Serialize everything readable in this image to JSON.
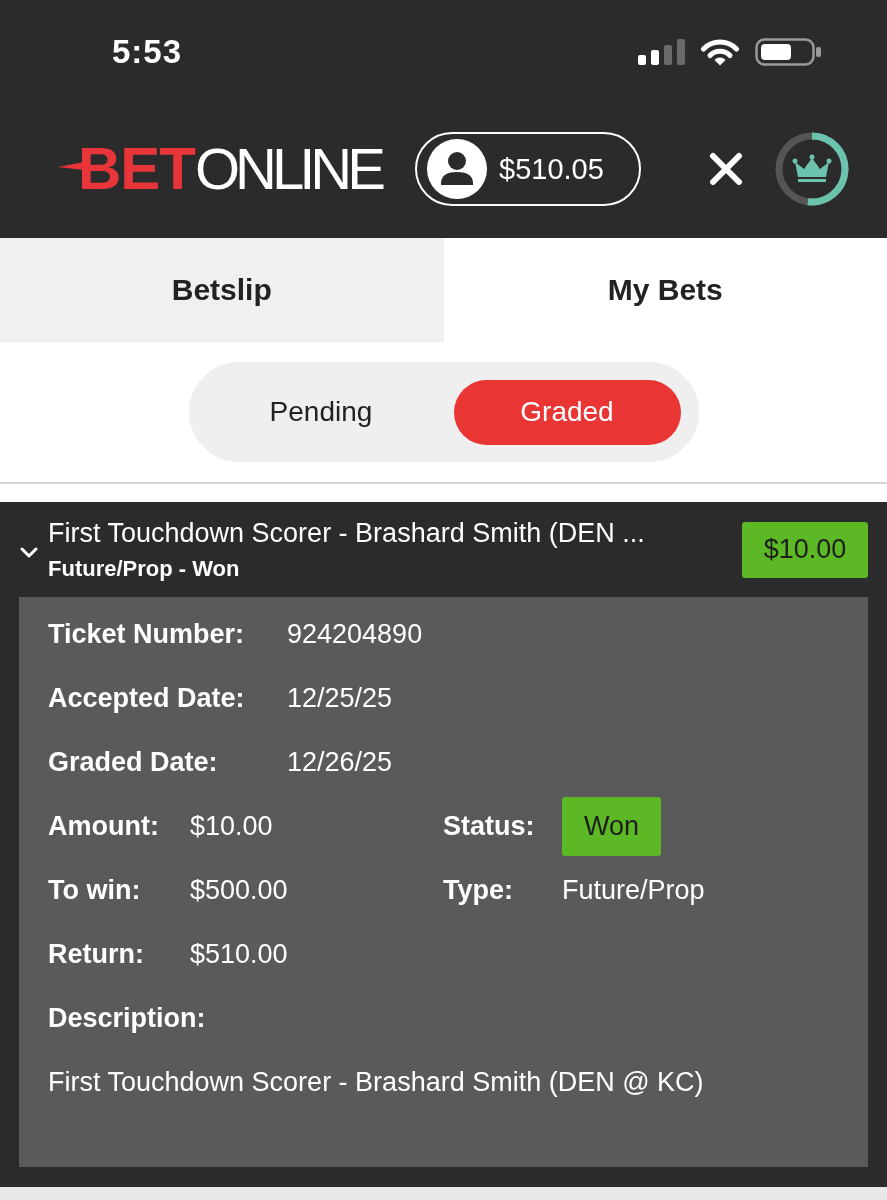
{
  "status_bar": {
    "time": "5:53"
  },
  "header": {
    "logo": [
      "BET",
      "ONLINE"
    ],
    "balance": "$510.05",
    "rewards": {
      "level": 0.52
    }
  },
  "tabs": [
    {
      "label": "Betslip",
      "selected": false
    },
    {
      "label": "My Bets",
      "selected": true
    }
  ],
  "filters": [
    {
      "label": "Pending",
      "selected": false
    },
    {
      "label": "Graded",
      "selected": true
    }
  ],
  "bets": [
    {
      "title": "First Touchdown Scorer - Brashard Smith (DEN ...",
      "subtitle": "Future/Prop - Won",
      "amount": "$10.00",
      "expanded": true,
      "info": [
        {
          "label": "Ticket Number:",
          "value": "924204890"
        },
        {
          "label": "Accepted Date:",
          "value": "12/25/25"
        },
        {
          "label": "Graded Date:",
          "value": "12/26/25"
        }
      ],
      "summary": [
        {
          "label": "Amount:",
          "value": "$10.00",
          "kind": "text"
        },
        {
          "label": "Status:",
          "value": "Won",
          "kind": "badge"
        },
        {
          "label": "To win:",
          "value": "$500.00",
          "kind": "text"
        },
        {
          "label": "Type:",
          "value": "Future/Prop",
          "kind": "text"
        },
        {
          "label": "Return:",
          "value": "$510.00",
          "kind": "text"
        }
      ],
      "description": {
        "label": "Description:",
        "text": "First Touchdown Scorer - Brashard Smith (DEN @ KC)"
      }
    }
  ]
}
